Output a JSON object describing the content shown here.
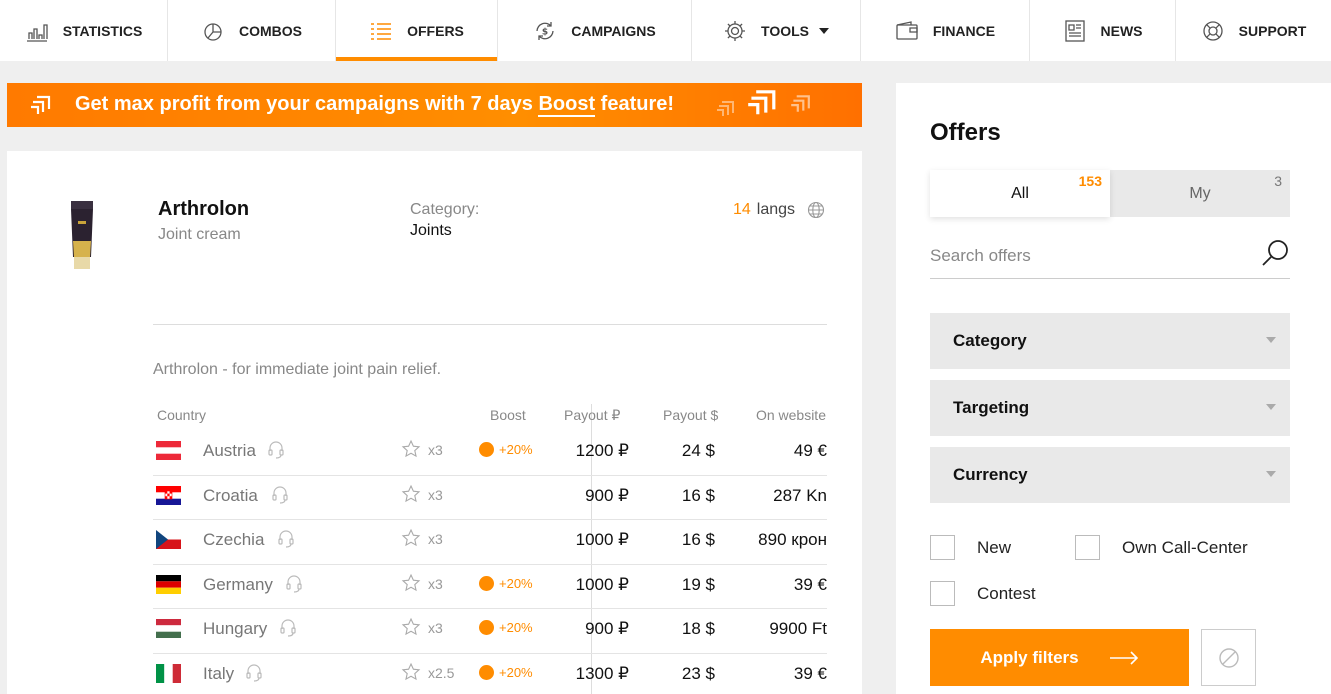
{
  "nav": {
    "items": [
      {
        "label": "STATISTICS",
        "icon": "bar-chart-icon"
      },
      {
        "label": "COMBOS",
        "icon": "pie-chart-icon"
      },
      {
        "label": "OFFERS",
        "icon": "list-icon",
        "active": true
      },
      {
        "label": "CAMPAIGNS",
        "icon": "cycle-dollar-icon"
      },
      {
        "label": "TOOLS",
        "icon": "gear-icon",
        "dropdown": true
      },
      {
        "label": "FINANCE",
        "icon": "wallet-icon"
      },
      {
        "label": "NEWS",
        "icon": "newspaper-icon"
      },
      {
        "label": "SUPPORT",
        "icon": "lifebuoy-icon"
      }
    ],
    "accent": "#ff8c00"
  },
  "banner": {
    "text_before": "Get max profit from your campaigns with 7 days ",
    "boost_word": "Boost",
    "text_after": " feature!"
  },
  "offer": {
    "name": "Arthrolon",
    "subtitle": "Joint cream",
    "category_label": "Category:",
    "category_value": "Joints",
    "langs_count": "14",
    "langs_label": "langs",
    "description": "Arthrolon - for immediate joint pain relief."
  },
  "table": {
    "headers": {
      "country": "Country",
      "boost": "Boost",
      "payout_rub": "Payout ₽",
      "payout_usd": "Payout $",
      "website": "On website"
    },
    "rows": [
      {
        "country": "Austria",
        "flag": "austria",
        "mult": "x3",
        "boost": "+20%",
        "payout_rub": "1200 ₽",
        "payout_usd": "24 $",
        "website": "49 €"
      },
      {
        "country": "Croatia",
        "flag": "croatia",
        "mult": "x3",
        "boost": "",
        "payout_rub": "900 ₽",
        "payout_usd": "16 $",
        "website": "287 Kn"
      },
      {
        "country": "Czechia",
        "flag": "czechia",
        "mult": "x3",
        "boost": "",
        "payout_rub": "1000 ₽",
        "payout_usd": "16 $",
        "website": "890 крон"
      },
      {
        "country": "Germany",
        "flag": "germany",
        "mult": "x3",
        "boost": "+20%",
        "payout_rub": "1000 ₽",
        "payout_usd": "19 $",
        "website": "39 €"
      },
      {
        "country": "Hungary",
        "flag": "hungary",
        "mult": "x3",
        "boost": "+20%",
        "payout_rub": "900 ₽",
        "payout_usd": "18 $",
        "website": "9900 Ft"
      },
      {
        "country": "Italy",
        "flag": "italy",
        "mult": "x2.5",
        "boost": "+20%",
        "payout_rub": "1300 ₽",
        "payout_usd": "23 $",
        "website": "39 €"
      }
    ]
  },
  "panel": {
    "title": "Offers",
    "tabs": {
      "all_label": "All",
      "all_count": "153",
      "my_label": "My",
      "my_count": "3"
    },
    "search_placeholder": "Search offers",
    "filters": [
      "Category",
      "Targeting",
      "Currency"
    ],
    "checkboxes": {
      "new": "New",
      "own_call_center": "Own Call-Center",
      "contest": "Contest"
    },
    "apply_label": "Apply filters"
  }
}
